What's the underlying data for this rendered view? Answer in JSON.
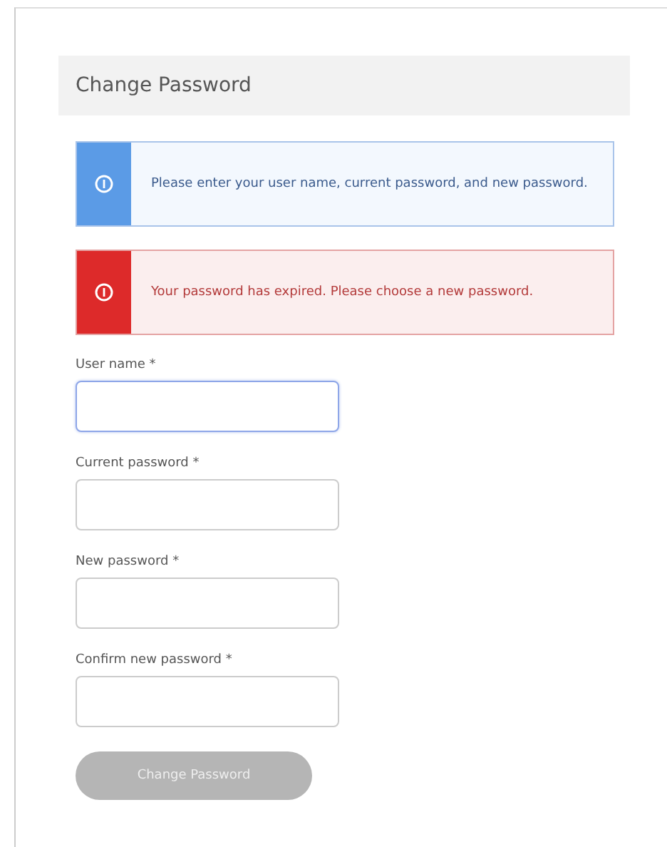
{
  "title": "Change Password",
  "alerts": [
    {
      "kind": "info",
      "text": "Please enter your user name, current password, and new password."
    },
    {
      "kind": "error",
      "text": "Your password has expired. Please choose a new password."
    }
  ],
  "fields": [
    {
      "label": "User name *",
      "focused": true
    },
    {
      "label": "Current password *",
      "focused": false
    },
    {
      "label": "New password *",
      "focused": false
    },
    {
      "label": "Confirm new password *",
      "focused": false
    }
  ],
  "submit": {
    "label": "Change Password",
    "disabled": true
  }
}
